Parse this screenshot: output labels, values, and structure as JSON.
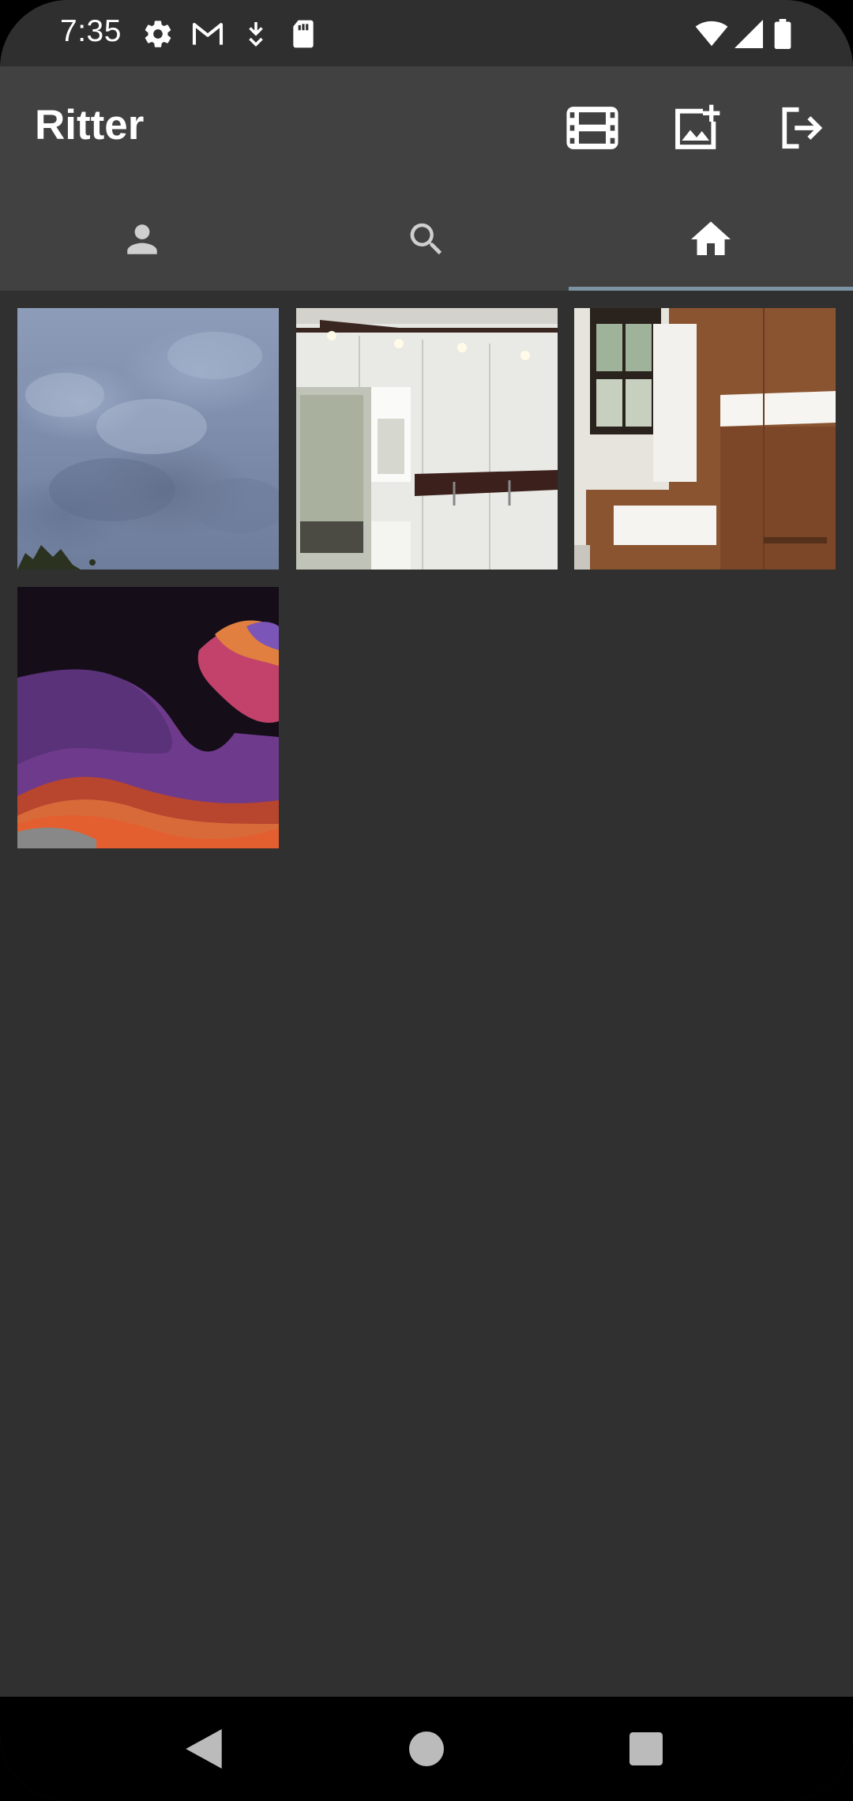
{
  "status_bar": {
    "time": "7:35",
    "left_icons": [
      "settings-icon",
      "gmail-icon",
      "download-icon",
      "sd-card-icon"
    ],
    "right_icons": [
      "wifi-icon",
      "signal-icon",
      "battery-icon"
    ]
  },
  "app_bar": {
    "title": "Ritter",
    "actions": [
      "film-icon",
      "add-photo-icon",
      "logout-icon"
    ]
  },
  "tabs": [
    {
      "name": "profile",
      "icon": "person-icon",
      "active": false
    },
    {
      "name": "search",
      "icon": "search-icon",
      "active": false
    },
    {
      "name": "home",
      "icon": "home-icon",
      "active": true
    }
  ],
  "grid": {
    "images": [
      "cloudy-sky-photo",
      "white-wardrobe-photo",
      "wooden-dresser-photo",
      "abstract-wave-wallpaper"
    ]
  },
  "nav_bar": {
    "buttons": [
      "back-icon",
      "home-circle-icon",
      "recents-icon"
    ]
  },
  "colors": {
    "background": "#303030",
    "app_bar": "#414141",
    "status_bar": "#2f2f2f",
    "tab_indicator": "#7a95a1",
    "icon_active": "#ffffff",
    "icon_inactive": "#cfcfcf"
  }
}
